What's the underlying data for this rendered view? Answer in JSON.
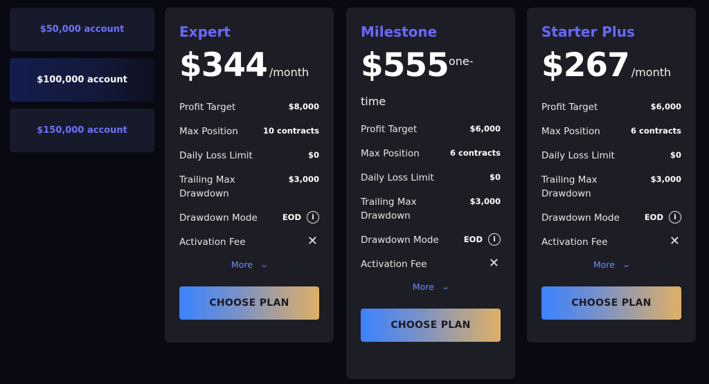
{
  "accounts": [
    {
      "label": "$50,000 account"
    },
    {
      "label": "$100,000 account"
    },
    {
      "label": "$150,000 account"
    }
  ],
  "selected_account": "$100,000 account",
  "plans": [
    {
      "name": "Expert",
      "price": "$344",
      "period": "/month",
      "features": {
        "profit_target": {
          "label": "Profit Target",
          "value": "$8,000"
        },
        "max_position": {
          "label": "Max Position",
          "value": "10 contracts"
        },
        "daily_loss": {
          "label": "Daily Loss Limit",
          "value": "$0"
        },
        "trailing": {
          "label": "Trailing Max Drawdown",
          "value": "$3,000"
        },
        "mode": {
          "label": "Drawdown Mode",
          "value": "EOD"
        },
        "activation": {
          "label": "Activation Fee"
        }
      },
      "more_label": "More",
      "cta": "CHOOSE PLAN"
    },
    {
      "name": "Milestone",
      "price": "$555",
      "period": "one-time",
      "features": {
        "profit_target": {
          "label": "Profit Target",
          "value": "$6,000"
        },
        "max_position": {
          "label": "Max Position",
          "value": "6 contracts"
        },
        "daily_loss": {
          "label": "Daily Loss Limit",
          "value": "$0"
        },
        "trailing": {
          "label": "Trailing Max Drawdown",
          "value": "$3,000"
        },
        "mode": {
          "label": "Drawdown Mode",
          "value": "EOD"
        },
        "activation": {
          "label": "Activation Fee"
        }
      },
      "more_label": "More",
      "cta": "CHOOSE PLAN"
    },
    {
      "name": "Starter Plus",
      "price": "$267",
      "period": "/month",
      "features": {
        "profit_target": {
          "label": "Profit Target",
          "value": "$6,000"
        },
        "max_position": {
          "label": "Max Position",
          "value": "6 contracts"
        },
        "daily_loss": {
          "label": "Daily Loss Limit",
          "value": "$0"
        },
        "trailing": {
          "label": "Trailing Max Drawdown",
          "value": "$3,000"
        },
        "mode": {
          "label": "Drawdown Mode",
          "value": "EOD"
        },
        "activation": {
          "label": "Activation Fee"
        }
      },
      "more_label": "More",
      "cta": "CHOOSE PLAN"
    }
  ],
  "icons": {
    "info": "info-icon",
    "activation_fee": "close-icon",
    "more": "chevron-down-icon"
  },
  "colors": {
    "accent": "#6a68ff",
    "link": "#6b8bff",
    "card_bg": "#1d1e25",
    "page_bg": "#080912",
    "cta_gradient_start": "#3a82ff",
    "cta_gradient_end": "#dfb066"
  }
}
